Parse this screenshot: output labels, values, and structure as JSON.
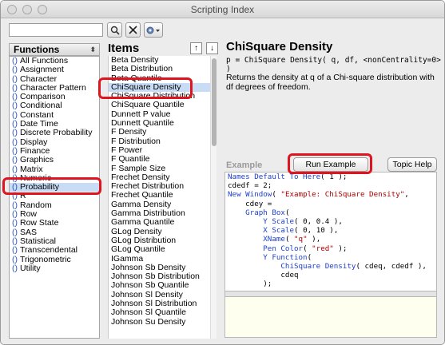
{
  "window": {
    "title": "Scripting Index"
  },
  "toolbar": {
    "search_value": "",
    "search_icon": "magnifier-icon",
    "clear_icon": "x-icon",
    "options_icon": "gear-dropdown-icon"
  },
  "functions": {
    "header": "Functions",
    "items": [
      "All Functions",
      "Assignment",
      "Character",
      "Character Pattern",
      "Comparison",
      "Conditional",
      "Constant",
      "Date Time",
      "Discrete Probability",
      "Display",
      "Finance",
      "Graphics",
      "Matrix",
      "Numeric",
      "Probability",
      "R",
      "Random",
      "Row",
      "Row State",
      "SAS",
      "Statistical",
      "Transcendental",
      "Trigonometric",
      "Utility"
    ],
    "paren_glyph": "()",
    "selected_index": 14
  },
  "items": {
    "header": "Items",
    "move_up": "↑",
    "move_down": "↓",
    "list": [
      "Beta Density",
      "Beta Distribution",
      "Beta Quantile",
      "ChiSquare Density",
      "ChiSquare Distribution",
      "ChiSquare Quantile",
      "Dunnett P value",
      "Dunnett Quantile",
      "F Density",
      "F Distribution",
      "F Power",
      "F Quantile",
      "F Sample Size",
      "Frechet Density",
      "Frechet Distribution",
      "Frechet Quantile",
      "Gamma Density",
      "Gamma Distribution",
      "Gamma Quantile",
      "GLog Density",
      "GLog Distribution",
      "GLog Quantile",
      "IGamma",
      "Johnson Sb Density",
      "Johnson Sb Distribution",
      "Johnson Sb Quantile",
      "Johnson Sl Density",
      "Johnson Sl Distribution",
      "Johnson Sl Quantile",
      "Johnson Su Density"
    ],
    "selected_index": 3
  },
  "detail": {
    "title": "ChiSquare Density",
    "syntax": "p = ChiSquare Density( q, df, <nonCentrality=0> )",
    "description": "Returns the density at q of a Chi-square distribution with df degrees of freedom."
  },
  "example": {
    "label": "Example",
    "run_button": "Run Example",
    "topic_help_button": "Topic Help",
    "code_lines": [
      "Names Default To Here( 1 );",
      "cdedf = 2;",
      "New Window( \"Example: ChiSquare Density\",",
      "    cdey =",
      "    Graph Box(",
      "        Y Scale( 0, 0.4 ),",
      "        X Scale( 0, 10 ),",
      "        XName( \"q\" ),",
      "        Pen Color( \"red\" );",
      "        Y Function(",
      "            ChiSquare Density( cdeq, cdedf ),",
      "            cdeq",
      "        );"
    ],
    "output_text": ""
  },
  "colors": {
    "highlight": "#e0141e",
    "selection": "#c8dcf5",
    "keyword": "#1f3fd1",
    "string": "#b30000"
  }
}
